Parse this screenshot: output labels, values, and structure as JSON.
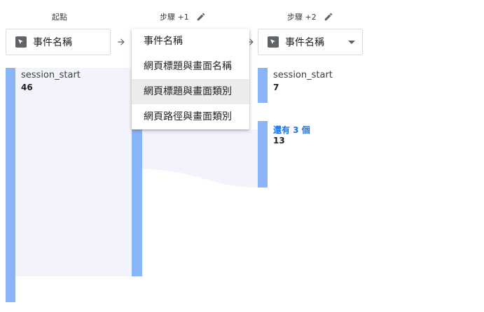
{
  "columns": {
    "start": {
      "header": "起點"
    },
    "step1": {
      "header": "步驟 +1"
    },
    "step2": {
      "header": "步驟 +2"
    }
  },
  "selectors": {
    "start": {
      "value": "事件名稱"
    },
    "step2": {
      "value": "事件名稱"
    }
  },
  "dropdown_menu": {
    "items": [
      {
        "label": "事件名稱"
      },
      {
        "label": "網頁標題與畫面名稱"
      },
      {
        "label": "網頁標題與畫面類別"
      },
      {
        "label": "網頁路徑與畫面類別"
      }
    ],
    "hovered_index": 2
  },
  "nodes": {
    "start": {
      "label": "session_start",
      "value": "46"
    },
    "step2_first": {
      "label": "session_start",
      "value": "7"
    },
    "step2_more": {
      "label": "還有 3 個",
      "value": "13"
    }
  },
  "colors": {
    "bar": "#8ab4f8",
    "flow": "#f3f4fb",
    "more_link": "#1a73e8",
    "menu_hover": "#ececec"
  }
}
